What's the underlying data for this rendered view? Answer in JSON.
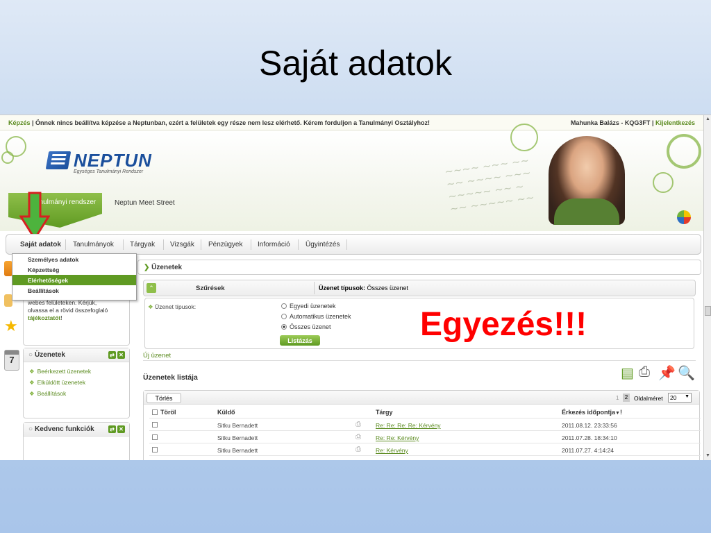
{
  "slide": {
    "title": "Saját adatok",
    "callout": "Egyezés!!!"
  },
  "topbar": {
    "link1": "Képzés",
    "message": " | Önnek nincs beállítva képzése a Neptunban, ezért a felületek egy része nem lesz elérhető. Kérem forduljon a Tanulmányi Osztályhoz!",
    "user": "Mahunka Balázs - KQG3FT",
    "sep": " | ",
    "logout": "Kijelentkezés"
  },
  "header": {
    "logo_text": "NEPTUN",
    "logo_tagline": "Egységes Tanulmányi Rendszer",
    "tab_active": "Tanulmányi rendszer",
    "tab_other": "Neptun Meet Street"
  },
  "nav": {
    "items": [
      "Saját adatok",
      "Tanulmányok",
      "Tárgyak",
      "Vizsgák",
      "Pénzügyek",
      "Információ",
      "Ügyintézés"
    ]
  },
  "dropdown": {
    "items": [
      "Személyes adatok",
      "Képzettség",
      "Elérhetőségek",
      "Beállítások"
    ],
    "selected": "Elérhetőségek"
  },
  "left": {
    "notice_line1": "webes felületeken. Kérjük,",
    "notice_line2": "olvassa el a rövid összefoglaló",
    "notice_link": "tájékoztatót",
    "notice_end": "!",
    "messages_title": "Üzenetek",
    "messages_links": [
      "Beérkezett üzenetek",
      "Elküldött üzenetek",
      "Beállítások"
    ],
    "favorites_title": "Kedvenc funkciók",
    "calendar_day": "7"
  },
  "main": {
    "title": "Üzenetek",
    "filters_label": "Szűrések",
    "types_label": "Üzenet típusok:",
    "types_value": " Összes üzenet",
    "filter_field": "Üzenet típusok:",
    "radios": [
      "Egyedi üzenetek",
      "Automatikus üzenetek",
      "Összes üzenet"
    ],
    "radio_selected": "Összes üzenet",
    "list_button": "Listázás",
    "new_message": "Új üzenet",
    "list_title": "Üzenetek listája",
    "delete_button": "Törlés",
    "pages": [
      "1",
      "2"
    ],
    "page_size_label": "Oldalméret",
    "page_size": "20",
    "columns": [
      "Töröl",
      "Küldő",
      "Tárgy",
      "Érkezés időpontja"
    ],
    "rows": [
      {
        "sender": "Sitku Bernadett",
        "subject": "Re: Re: Re: Re: Kérvény",
        "date": "2011.08.12. 23:33:56"
      },
      {
        "sender": "Sitku Bernadett",
        "subject": "Re: Re: Kérvény",
        "date": "2011.07.28. 18:34:10"
      },
      {
        "sender": "Sitku Bernadett",
        "subject": "Re: Kérvény",
        "date": "2011.07.27. 4:14:24"
      }
    ]
  },
  "colors": {
    "brand_green": "#5f9a22",
    "link_green": "#5a8a1e",
    "callout_red": "#ff0000",
    "logo_blue": "#1a4f9c"
  },
  "icons": [
    "arrow-down-icon",
    "star-icon",
    "calendar-icon",
    "excel-export-icon",
    "print-icon",
    "pin-icon",
    "search-icon",
    "print-row-icon"
  ]
}
